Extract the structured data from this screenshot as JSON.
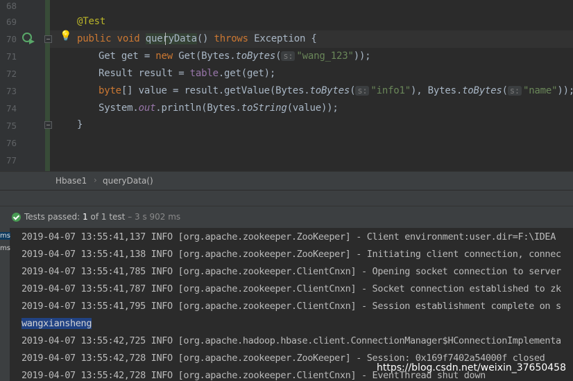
{
  "editor": {
    "line_numbers": [
      "68",
      "69",
      "70",
      "71",
      "72",
      "73",
      "74",
      "75",
      "76",
      "77"
    ],
    "lines": {
      "l69": {
        "annotation": "@Test"
      },
      "l70": {
        "kw1": "public",
        "kw2": "void",
        "method": "queryData",
        "paren": "() ",
        "throws_kw": "throws",
        "rest": " Exception {"
      },
      "l71": {
        "a": "Get get = ",
        "new_kw": "new",
        "b": " Get(Bytes.",
        "fn": "toBytes",
        "c": "(",
        "hint": "s:",
        "str": "\"wang_123\"",
        "d": "));"
      },
      "l72": {
        "a": "Result result = ",
        "field": "table",
        "b": ".get(get);"
      },
      "l73": {
        "type_kw": "byte",
        "a": "[] value = result.getValue(Bytes.",
        "fn1": "toBytes",
        "b": "(",
        "hint1": "s:",
        "str1": "\"info1\"",
        "c": "), Bytes.",
        "fn2": "toBytes",
        "d": "(",
        "hint2": "s:",
        "str2": "\"name\"",
        "e": "));"
      },
      "l74": {
        "a": "System.",
        "field": "out",
        "b": ".println(Bytes.",
        "fn": "toString",
        "c": "(value));"
      },
      "l75": {
        "brace": "}"
      }
    },
    "icons": {
      "run": "run-test-icon",
      "bulb": "lightbulb-icon",
      "fold": "fold-icon"
    }
  },
  "breadcrumb": {
    "class_name": "Hbase1",
    "separator": "›",
    "method": "queryData()"
  },
  "status": {
    "prefix": "Tests passed: ",
    "passed": "1",
    "of_text": " of 1 test",
    "time": " – 3 s 902 ms"
  },
  "console": {
    "left_tags": [
      "ms",
      "ms"
    ],
    "lines": [
      "2019-04-07 13:55:41,137 INFO [org.apache.zookeeper.ZooKeeper] - Client environment:user.dir=F:\\IDEA",
      "2019-04-07 13:55:41,138 INFO [org.apache.zookeeper.ZooKeeper] - Initiating client connection, connec",
      "2019-04-07 13:55:41,785 INFO [org.apache.zookeeper.ClientCnxn] - Opening socket connection to server",
      "2019-04-07 13:55:41,787 INFO [org.apache.zookeeper.ClientCnxn] - Socket connection established to zk",
      "2019-04-07 13:55:41,795 INFO [org.apache.zookeeper.ClientCnxn] - Session establishment complete on s",
      "wangxiansheng",
      "2019-04-07 13:55:42,725 INFO [org.apache.hadoop.hbase.client.ConnectionManager$HConnectionImplementa",
      "2019-04-07 13:55:42,728 INFO [org.apache.zookeeper.ZooKeeper] - Session: 0x169f7402a54000f closed",
      "2019-04-07 13:55:42,728 INFO [org.apache.zookeeper.ClientCnxn] - EventThread shut down"
    ],
    "watermark": "https://blog.csdn.net/weixin_37650458"
  },
  "colors": {
    "keyword": "#cc7832",
    "string": "#6a8759",
    "annotation": "#bbb529",
    "field": "#9876aa",
    "success": "#499c54",
    "selection": "#214283"
  }
}
